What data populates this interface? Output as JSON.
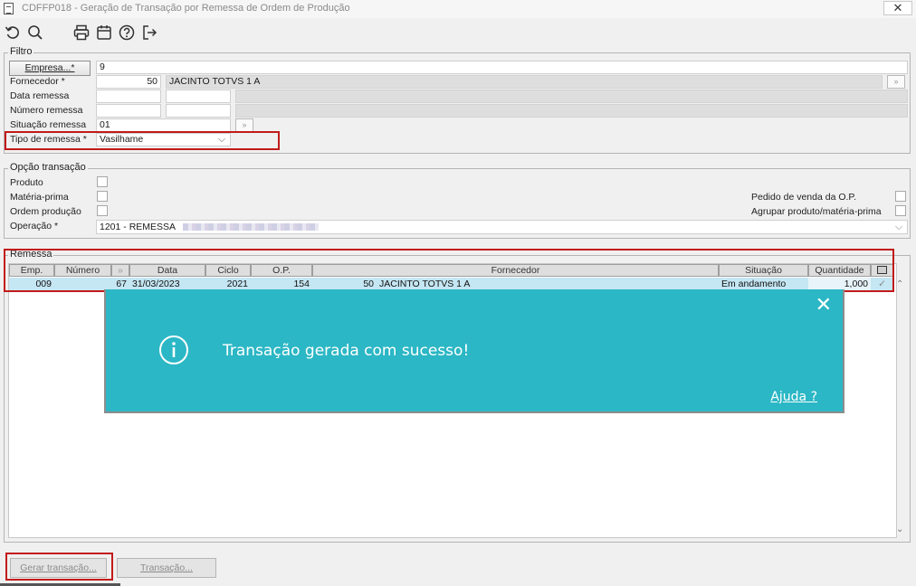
{
  "window": {
    "title": "CDFFP018 - Geração de Transação por Remessa de Ordem de Produção",
    "close_glyph": "✕"
  },
  "toolbar": {
    "icons": [
      "refresh-icon",
      "search-icon",
      "print-icon",
      "calendar-icon",
      "help-icon",
      "exit-icon"
    ]
  },
  "filtro": {
    "title": "Filtro",
    "empresa_button": "Empresa...*",
    "empresa_value": "9",
    "fornecedor_label": "Fornecedor *",
    "fornecedor_code": "50",
    "fornecedor_name": "JACINTO TOTVS 1 A",
    "data_remessa_label": "Data remessa",
    "numero_remessa_label": "Número remessa",
    "situacao_remessa_label": "Situação remessa",
    "situacao_remessa_value": "01",
    "tipo_remessa_label": "Tipo de remessa *",
    "tipo_remessa_value": "Vasilhame",
    "zoom_glyph": "»"
  },
  "opcao": {
    "title": "Opção transação",
    "produto_label": "Produto",
    "materia_prima_label": "Matéria-prima",
    "ordem_producao_label": "Ordem produção",
    "operacao_label": "Operação *",
    "operacao_value": "1201 - REMESSA",
    "pedido_venda_label": "Pedido de venda da O.P.",
    "agrupar_label": "Agrupar produto/matéria-prima"
  },
  "remessa": {
    "title": "Remessa",
    "columns": [
      "Emp.",
      "Número",
      "»",
      "Data",
      "Ciclo",
      "O.P.",
      "Fornecedor",
      "Situação",
      "Quantidade"
    ],
    "rows": [
      {
        "emp": "009",
        "numero": "67",
        "data": "31/03/2023",
        "ciclo": "2021",
        "op": "154",
        "forn_code": "50",
        "forn_name": "JACINTO TOTVS 1 A",
        "situacao": "Em andamento",
        "quantidade": "1,000"
      }
    ]
  },
  "buttons": {
    "gerar": "Gerar transação...",
    "transacao": "Transação..."
  },
  "toast": {
    "message": "Transação gerada com sucesso!",
    "help": "Ajuda ?",
    "close": "✕"
  },
  "colors": {
    "toast_bg": "#2bb7c5",
    "highlight": "#c21a1a",
    "row_selected": "#c5e6f3"
  }
}
